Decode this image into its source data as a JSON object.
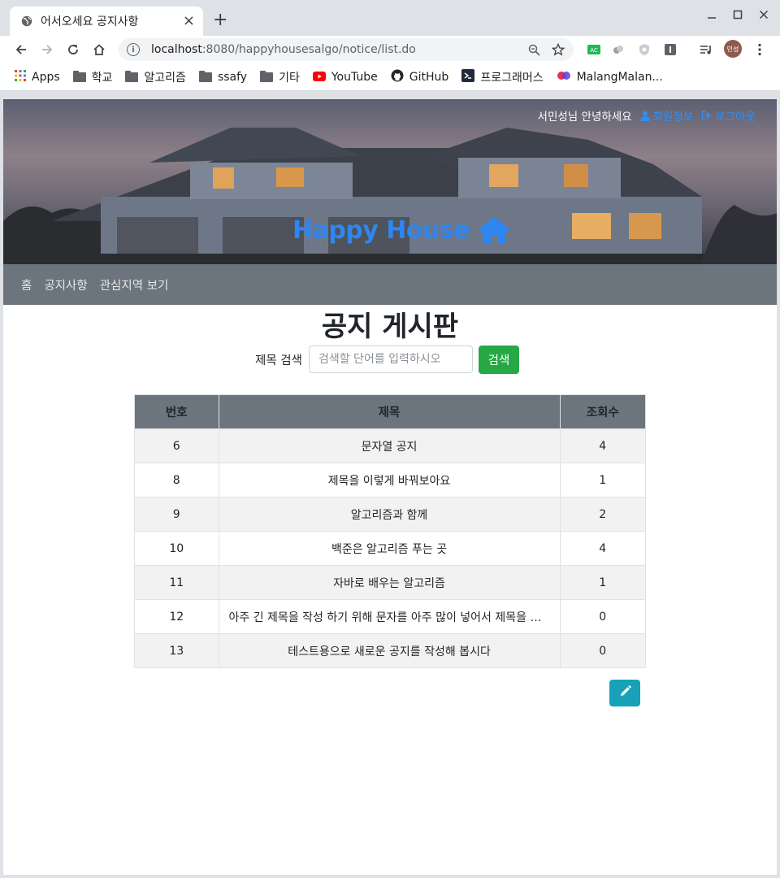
{
  "browser": {
    "tab_title": "어서오세요 공지사항",
    "url_host": "localhost",
    "url_rest": ":8080/happyhousesalgo/notice/list.do",
    "profile_initials": "민성",
    "bookmarks": [
      {
        "label": "Apps",
        "icon": "apps-grid-icon"
      },
      {
        "label": "학교",
        "icon": "folder-icon"
      },
      {
        "label": "알고리즘",
        "icon": "folder-icon"
      },
      {
        "label": "ssafy",
        "icon": "folder-icon"
      },
      {
        "label": "기타",
        "icon": "folder-icon"
      },
      {
        "label": "YouTube",
        "icon": "youtube-icon"
      },
      {
        "label": "GitHub",
        "icon": "github-icon"
      },
      {
        "label": "프로그래머스",
        "icon": "programmers-icon"
      },
      {
        "label": "MalangMalan...",
        "icon": "malang-icon"
      }
    ]
  },
  "header": {
    "greeting": "서민성님 안녕하세요",
    "member_info": "회원정보",
    "logout": "로그아웃",
    "brand": "Happy House",
    "brand_color": "#2f86f0"
  },
  "nav": {
    "home": "홈",
    "notice": "공지사항",
    "interest": "관심지역 보기"
  },
  "board": {
    "title": "공지 게시판",
    "search_label": "제목 검색",
    "search_placeholder": "검색할 단어를 입력하시오",
    "search_button": "검색",
    "columns": {
      "no": "번호",
      "title": "제목",
      "views": "조회수"
    },
    "rows": [
      {
        "no": "6",
        "title": "문자열 공지",
        "views": "4"
      },
      {
        "no": "8",
        "title": "제목을 이렇게 바꿔보아요",
        "views": "1"
      },
      {
        "no": "9",
        "title": "알고리즘과 함께",
        "views": "2"
      },
      {
        "no": "10",
        "title": "백준은 알고리즘 푸는 곳",
        "views": "4"
      },
      {
        "no": "11",
        "title": "자바로 배우는 알고리즘",
        "views": "1"
      },
      {
        "no": "12",
        "title": "아주 긴 제목을 작성 하기 위해 문자를 아주 많이 넣어서 제목을 작성해 봅시다",
        "views": "0"
      },
      {
        "no": "13",
        "title": "테스트용으로 새로운 공지를 작성해 봅시다",
        "views": "0"
      }
    ],
    "write_icon": "pencil-icon",
    "colors": {
      "header_bg": "#6c757d",
      "search_btn": "#28a745",
      "write_btn": "#17a2b8"
    }
  }
}
